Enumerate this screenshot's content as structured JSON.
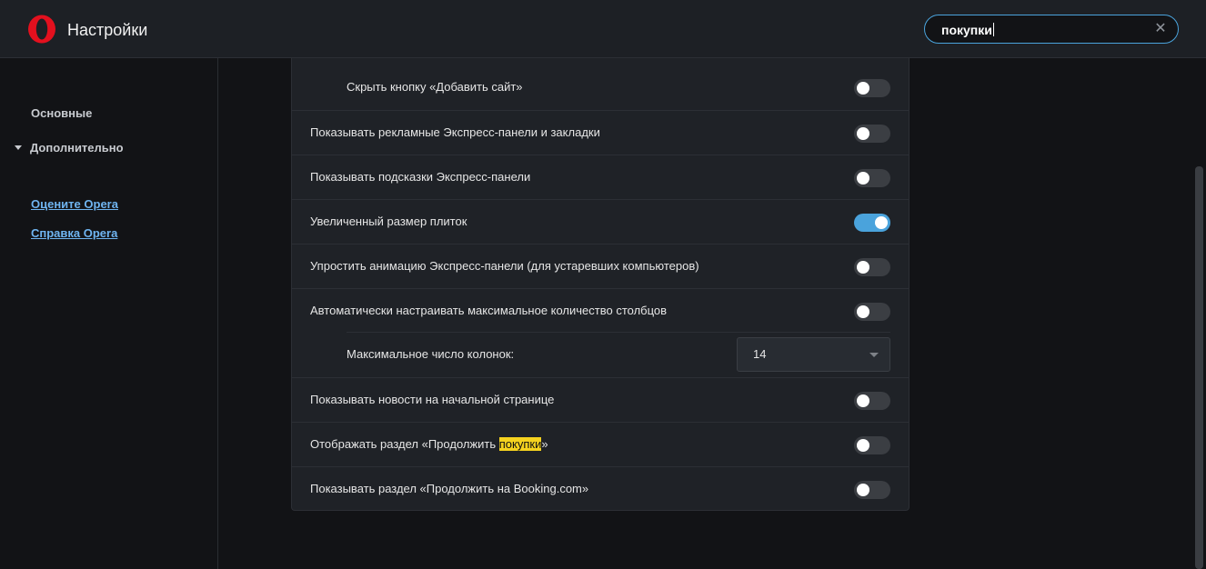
{
  "header": {
    "title": "Настройки",
    "logo_icon": "opera-logo",
    "search": {
      "value": "покупки",
      "clear_icon": "close-icon"
    }
  },
  "sidebar": {
    "items": [
      {
        "label": "Основные",
        "expanded": false
      },
      {
        "label": "Дополнительно",
        "expanded": true
      }
    ],
    "links": [
      {
        "label": "Оцените Opera"
      },
      {
        "label": "Справка Opera"
      }
    ]
  },
  "settings": {
    "hide_add_site": {
      "label": "Скрыть кнопку «Добавить сайт»",
      "enabled": false
    },
    "promo_speed_dials": {
      "label": "Показывать рекламные Экспресс-панели и закладки",
      "enabled": false
    },
    "speed_dial_hints": {
      "label": "Показывать подсказки Экспресс-панели",
      "enabled": false
    },
    "large_tiles": {
      "label": "Увеличенный размер плиток",
      "enabled": true
    },
    "simplify_animation": {
      "label": "Упростить анимацию Экспресс-панели (для устаревших компьютеров)",
      "enabled": false
    },
    "auto_columns": {
      "label": "Автоматически настраивать максимальное количество столбцов",
      "enabled": false
    },
    "max_columns": {
      "label": "Максимальное число колонок:",
      "value": "14"
    },
    "news_start_page": {
      "label": "Показывать новости на начальной странице",
      "enabled": false
    },
    "continue_shopping": {
      "label_prefix": "Отображать раздел «Продолжить ",
      "label_highlight": "покупки",
      "label_suffix": "»",
      "enabled": false
    },
    "continue_booking": {
      "label": "Показывать раздел «Продолжить на Booking.com»",
      "enabled": false
    }
  },
  "colors": {
    "accent": "#4aa3dc",
    "highlight": "#f5d21f",
    "brand": "#e3101e"
  }
}
